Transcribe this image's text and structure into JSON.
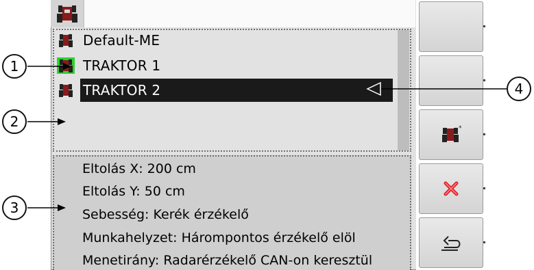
{
  "header": {
    "tab_icon": "tractor-icon"
  },
  "device_list": [
    {
      "name": "Default-ME",
      "icon": "tractor-icon",
      "active": false,
      "selected": false
    },
    {
      "name": "TRAKTOR 1",
      "icon": "tractor-icon",
      "active": true,
      "selected": false
    },
    {
      "name": "TRAKTOR 2",
      "icon": "tractor-icon",
      "active": false,
      "selected": true
    }
  ],
  "details": [
    "Eltolás X: 200 cm",
    "Eltolás Y: 50 cm",
    "Sebesség: Kerék érzékelő",
    "Munkahelyzet: Hárompontos érzékelő elöl",
    "Menetirány: Radarérzékelő CAN-on keresztül"
  ],
  "softkeys": [
    {
      "name": "softkey-1",
      "icon": ""
    },
    {
      "name": "softkey-2",
      "icon": ""
    },
    {
      "name": "softkey-new-tractor",
      "icon": "new-tractor-icon"
    },
    {
      "name": "softkey-delete",
      "icon": "delete-x-icon"
    },
    {
      "name": "softkey-back",
      "icon": "return-arrow-icon"
    }
  ],
  "callouts": [
    "1",
    "2",
    "3",
    "4"
  ],
  "colors": {
    "active_marker": "#2fd12f",
    "selection_bg": "#1a1a1a",
    "tractor_red": "#8b1a1a",
    "delete_red": "#e0202a"
  }
}
